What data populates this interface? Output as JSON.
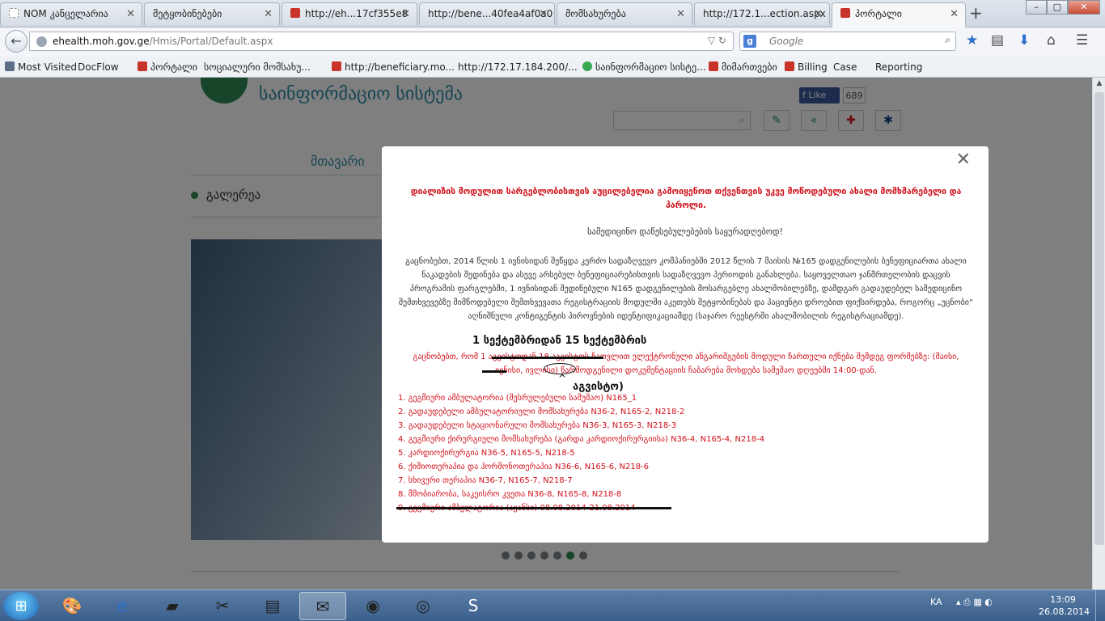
{
  "browser": {
    "tabs": [
      {
        "label": "NOM კანცელარია",
        "icon": "page-icon"
      },
      {
        "label": "მეტყობინებები",
        "icon": "page-icon"
      },
      {
        "label": "http://eh...17cf355e8",
        "icon": "portal-icon"
      },
      {
        "label": "http://bene...40fea4af0a0",
        "icon": "page-icon"
      },
      {
        "label": "მომსახურება",
        "icon": "page-icon"
      },
      {
        "label": "http://172.1...ection.aspx",
        "icon": "page-icon"
      },
      {
        "label": "პორტალი",
        "icon": "portal-icon"
      }
    ],
    "active_tab": 6,
    "url_host": "ehealth.moh.gov.ge",
    "url_path": "/Hmis/Portal/Default.aspx",
    "search_placeholder": "Google",
    "bookmarks": [
      {
        "label": "Most Visited",
        "icon": "mv"
      },
      {
        "label": "DocFlow",
        "icon": "page"
      },
      {
        "label": "პორტალი",
        "icon": "red"
      },
      {
        "label": "სოციალური მომსახუ...",
        "icon": "page"
      },
      {
        "label": "http://beneficiary.mo...",
        "icon": "red"
      },
      {
        "label": "http://172.17.184.200/...",
        "icon": "page"
      },
      {
        "label": "საინფორმაციო სისტე...",
        "icon": "green"
      },
      {
        "label": "მიმართვები",
        "icon": "red"
      },
      {
        "label": "Billing",
        "icon": "red"
      },
      {
        "label": "Case",
        "icon": "page"
      },
      {
        "label": "Reporting",
        "icon": "page"
      }
    ]
  },
  "portal": {
    "site_title": "საინფორმაციო სისტემა",
    "fb_like": "Like",
    "fb_count": "689",
    "menu_main": "მთავარი",
    "gallery": "გალერეა"
  },
  "modal": {
    "title": "დიალიზის მოდულით სარგებლობისთვის აუცილებელია გამოიყენოთ თქვენთვის უკვე მოწოდებული ახალი მომხმარებელი და პაროლი.",
    "greeting": "სამედიცინო დაწესებულებების საყურადღებოდ!",
    "paragraph": "გაცნობებთ, 2014 წლის 1 ივნისიდან შეწყდა კერძო სადაზღვევო კომპანიებში 2012 წლის 7 მაისის №165 დადგენილების ბენეფიციართა ახალი ნაკადების შედინება და ასევე არსებულ ბენეფიციარებისთვის სადაზღვევო პერიოდის განახლება. საყოველთაო ჯანმრთელობის დაცვის პროგრამის ფარგლებში, 1 ივნისიდან შედინებული N165 დადგენილების მოსარგებლე ახალშობილებზე, დამდგარ გადაუდებელ სამედიცინო შემთხვევებზე მიმწოდებელი შემთხვევათა რეგისტრაციის მოდულში აკეთებს შეტყობინებას და პაციენტი დროებით ფიქსირდება, როგორც „უცნობი“ აღნიშნული კონტიგენტის პიროვნების იდენტიფიკაციამდე (საჯარო რეესტრში ახალშობილის რეგისტრაციამდე).",
    "handwritten_1": "1 სექტემბრიდან 15 სექტემბრის",
    "paragraph2": "გაცნობებთ, რომ 1 აგვისტოდან 18 აგვისტოს ჩათვლით ელექტრონული ანგარიშგების მოდული ჩართული იქნება შემდეგ ფორმებზე: (მაისი, ივნისი, ივლისი) წარმოდგენილი დოკუმენტაციის ჩაბარება მოხდება სამუშაო დღეებში 14:00-დან.",
    "handwritten_2": "აგვისტო)",
    "items": [
      "1. გეგმიური ამბულატორია (შესრულებული სამუშაო) N165_1",
      "2. გადაუდებელი ამბულატორიული მომსახურება N36-2, N165-2, N218-2",
      "3. გადაუდებელი სტაციონარული მომსახურება N36-3, N165-3, N218-3",
      "4. გეგმიური ქირურგიული მომსახურება (გარდა კარდიოქირურგიისა) N36-4, N165-4, N218-4",
      "5. კარდიოქირურგია N36-5, N165-5, N218-5",
      "6. ქიმიოთერაპია და ჰორმონოთერაპია N36-6, N165-6, N218-6",
      "7. სხივური თერაპია N36-7, N165-7, N218-7",
      "8. მშობიარობა, საკეისრო კვეთა N36-8, N165-8, N218-8",
      "9. გეგმიური ამბულატორია (ავანსი) 08.08.2014-21.08.2014"
    ]
  },
  "taskbar": {
    "lang": "KA",
    "time": "13:09",
    "date": "26.08.2014"
  }
}
